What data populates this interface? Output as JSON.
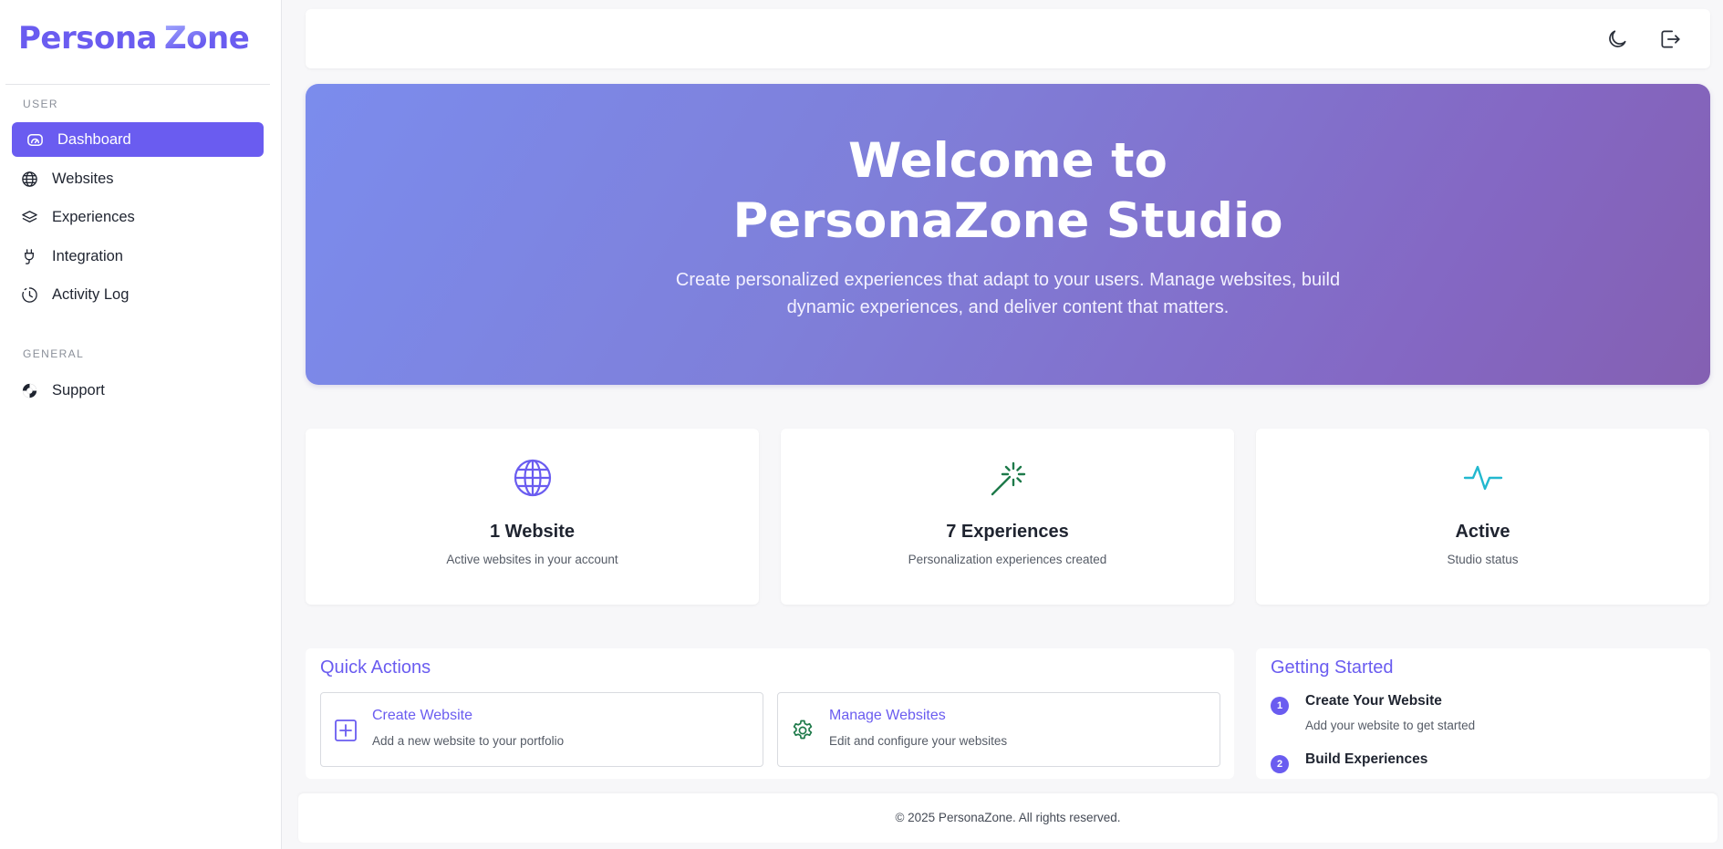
{
  "app": {
    "logo_part1": "Persona",
    "logo_part2": "Zone"
  },
  "sidebar": {
    "user_section": "USER",
    "general_section": "GENERAL",
    "items": [
      {
        "label": "Dashboard",
        "icon": "dashboard-gauge-icon",
        "active": true
      },
      {
        "label": "Websites",
        "icon": "globe-icon"
      },
      {
        "label": "Experiences",
        "icon": "layers-icon"
      },
      {
        "label": "Integration",
        "icon": "plug-icon"
      },
      {
        "label": "Activity Log",
        "icon": "clock-history-icon"
      }
    ],
    "general_items": [
      {
        "label": "Support",
        "icon": "life-ring-icon"
      }
    ]
  },
  "topbar": {
    "icons": [
      "moon-icon",
      "logout-icon"
    ]
  },
  "hero": {
    "title": "Welcome to PersonaZone Studio",
    "subtitle": "Create personalized experiences that adapt to your users. Manage websites, build dynamic experiences, and deliver content that matters."
  },
  "stats": [
    {
      "title": "1 Website",
      "subtitle": "Active websites in your account",
      "icon": "globe-icon",
      "color": "#6a5cf0"
    },
    {
      "title": "7 Experiences",
      "subtitle": "Personalization experiences created",
      "icon": "magic-wand-icon",
      "color": "#1e7a4a"
    },
    {
      "title": "Active",
      "subtitle": "Studio status",
      "icon": "activity-pulse-icon",
      "color": "#22b8cf"
    }
  ],
  "quick_actions": {
    "title": "Quick Actions",
    "items": [
      {
        "title": "Create Website",
        "subtitle": "Add a new website to your portfolio",
        "icon": "plus-square-icon"
      },
      {
        "title": "Manage Websites",
        "subtitle": "Edit and configure your websites",
        "icon": "gear-icon"
      }
    ]
  },
  "getting_started": {
    "title": "Getting Started",
    "steps": [
      {
        "num": "1",
        "title": "Create Your Website",
        "subtitle": "Add your website to get started"
      },
      {
        "num": "2",
        "title": "Build Experiences",
        "subtitle": ""
      }
    ]
  },
  "footer": {
    "text": "© 2025 PersonaZone. All rights reserved."
  },
  "colors": {
    "accent": "#6a5cf0",
    "background": "#f7f7f9"
  }
}
